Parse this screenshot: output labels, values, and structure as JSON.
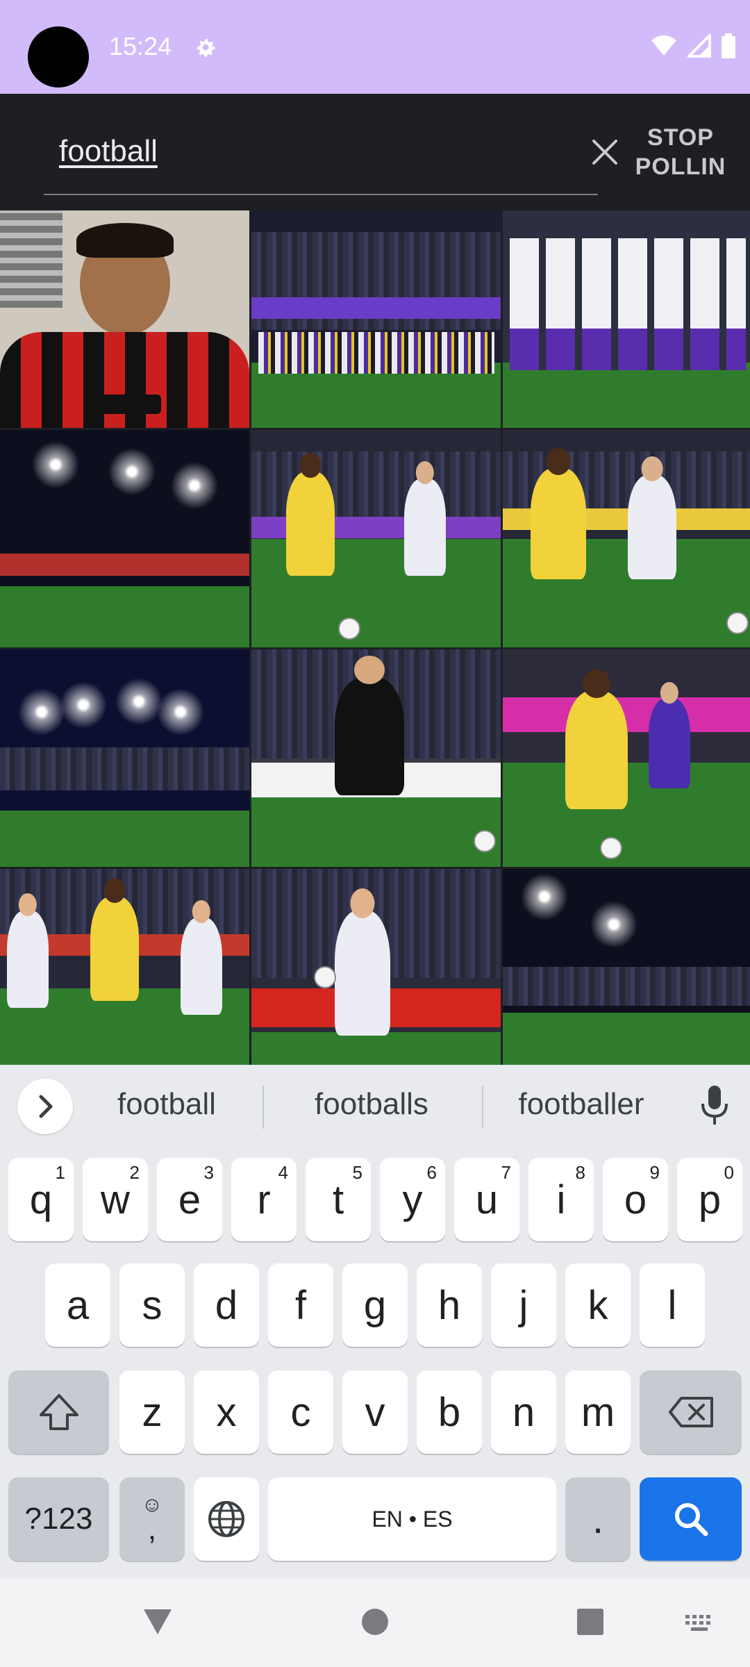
{
  "status_bar": {
    "time": "15:24",
    "icons": [
      "settings-icon",
      "wifi-icon",
      "signal-icon",
      "battery-icon"
    ]
  },
  "search": {
    "query": "football",
    "stop_label_line1": "STOP",
    "stop_label_line2": "POLLIN"
  },
  "suggestions": [
    "football",
    "footballs",
    "footballer"
  ],
  "keyboard": {
    "row1": [
      {
        "char": "q",
        "hint": "1"
      },
      {
        "char": "w",
        "hint": "2"
      },
      {
        "char": "e",
        "hint": "3"
      },
      {
        "char": "r",
        "hint": "4"
      },
      {
        "char": "t",
        "hint": "5"
      },
      {
        "char": "y",
        "hint": "6"
      },
      {
        "char": "u",
        "hint": "7"
      },
      {
        "char": "i",
        "hint": "8"
      },
      {
        "char": "o",
        "hint": "9"
      },
      {
        "char": "p",
        "hint": "0"
      }
    ],
    "row2": [
      "a",
      "s",
      "d",
      "f",
      "g",
      "h",
      "j",
      "k",
      "l"
    ],
    "row3": [
      "z",
      "x",
      "c",
      "v",
      "b",
      "n",
      "m"
    ],
    "symbols_label": "?123",
    "comma_label": ",",
    "space_label": "EN • ES",
    "period_label": "."
  },
  "colors": {
    "status_bar": "#d2bbfb",
    "app_bar": "#1e1f24",
    "accent": "#1a73e8",
    "keyboard_bg": "#e8eaed"
  }
}
